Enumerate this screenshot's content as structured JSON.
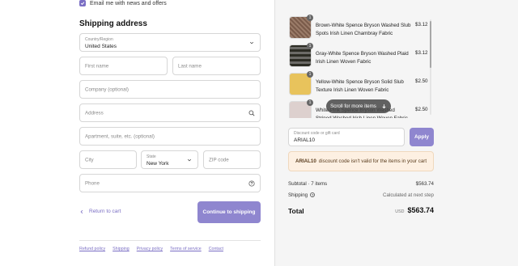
{
  "newsletter": {
    "label": "Email me with news and offers",
    "checked": true
  },
  "shipping": {
    "title": "Shipping address",
    "country_label": "Country/Region",
    "country_value": "United States",
    "first_name_ph": "First name",
    "last_name_ph": "Last name",
    "company_ph": "Company (optional)",
    "address_ph": "Address",
    "apartment_ph": "Apartment, suite, etc. (optional)",
    "city_ph": "City",
    "state_label": "State",
    "state_value": "New York",
    "zip_ph": "ZIP code",
    "phone_ph": "Phone"
  },
  "actions": {
    "return_label": "Return to cart",
    "continue_label": "Continue to shipping"
  },
  "footer": {
    "links": [
      "Refund policy",
      "Shipping",
      "Privacy policy",
      "Terms of service",
      "Contact"
    ]
  },
  "cart": {
    "items": [
      {
        "name": "Brown-White Spence Bryson Washed Slub Spots Irish Linen Chambray Fabric",
        "price": "$3.12",
        "qty": "1",
        "swatch": "#8a6a58"
      },
      {
        "name": "Gray-White Spence Bryson Washed Plaid Irish Linen Woven Fabric",
        "price": "$3.12",
        "qty": "1",
        "swatch": "#6f6f5d"
      },
      {
        "name": "Yellow-White Spence Bryson Solid Slub Texture Irish Linen Woven Fabric",
        "price": "$2.50",
        "qty": "1",
        "swatch": "#e6c25a"
      },
      {
        "name": "White-Pink Spence Bryson Washed Striped Washed Irish Linen Woven Fabric",
        "price": "$2.50",
        "qty": "1",
        "swatch": "#d9cdcb"
      }
    ],
    "scroll_hint": "Scroll for more items"
  },
  "discount": {
    "label": "Discount code or gift card",
    "value": "ARIAL10",
    "apply_label": "Apply"
  },
  "alert": {
    "code": "ARIAL10",
    "message": "discount code isn't valid for the items in your cart"
  },
  "summary": {
    "subtotal_label": "Subtotal · 7 items",
    "subtotal_value": "$563.74",
    "shipping_label": "Shipping",
    "shipping_value": "Calculated at next step",
    "total_label": "Total",
    "currency": "USD",
    "total_value": "$563.74"
  },
  "colors": {
    "accent": "#8f86cf",
    "link": "#7b6fc4",
    "alert_bg": "#fdf0e2"
  }
}
